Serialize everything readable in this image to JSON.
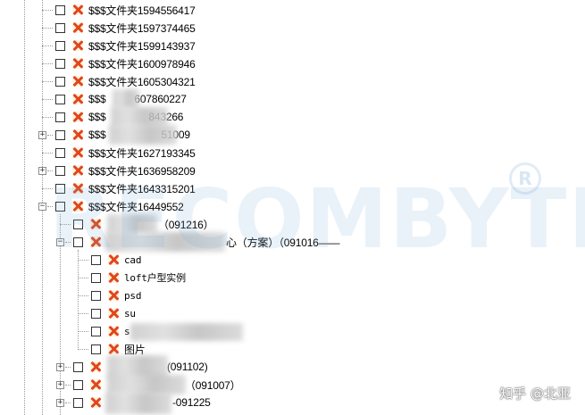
{
  "tree": {
    "level1": [
      {
        "label": "$$$文件夹1594556417",
        "expandable": false
      },
      {
        "label": "$$$文件夹1597374465",
        "expandable": false
      },
      {
        "label": "$$$文件夹1599143937",
        "expandable": false
      },
      {
        "label": "$$$文件夹1600978946",
        "expandable": false
      },
      {
        "label": "$$$文件夹1605304321",
        "expandable": false
      },
      {
        "label": "$$$",
        "suffix": "607860227",
        "expandable": false
      },
      {
        "label": "$$$",
        "suffix": "843266",
        "expandable": false
      },
      {
        "label": "$$$",
        "suffix": "51009",
        "expandable": true,
        "expander": "+"
      },
      {
        "label": "$$$文件夹1627193345",
        "expandable": false
      },
      {
        "label": "$$$文件夹1636958209",
        "expandable": true,
        "expander": "+"
      },
      {
        "label": "$$$文件夹1643315201",
        "expandable": false
      },
      {
        "label": "$$$文件夹16449552",
        "expandable": true,
        "expander": "−"
      }
    ],
    "level2": [
      {
        "label": "（091216）",
        "expandable": false
      },
      {
        "label": "心（方案）（091016——",
        "expandable": true,
        "expander": "−"
      }
    ],
    "level3": [
      {
        "label": "cad"
      },
      {
        "label": "loft户型实例"
      },
      {
        "label": "psd"
      },
      {
        "label": "su"
      },
      {
        "label": "s"
      },
      {
        "label": "图片"
      }
    ],
    "level2_after": [
      {
        "label": "(091102)",
        "expandable": true,
        "expander": "+"
      },
      {
        "label": "（091007）",
        "expandable": true,
        "expander": "+"
      },
      {
        "label": "-091225",
        "expandable": true,
        "expander": "+"
      }
    ]
  },
  "watermark": {
    "text": "RECOMBYTE",
    "mark": "R"
  },
  "credit": "知乎 @北亚"
}
